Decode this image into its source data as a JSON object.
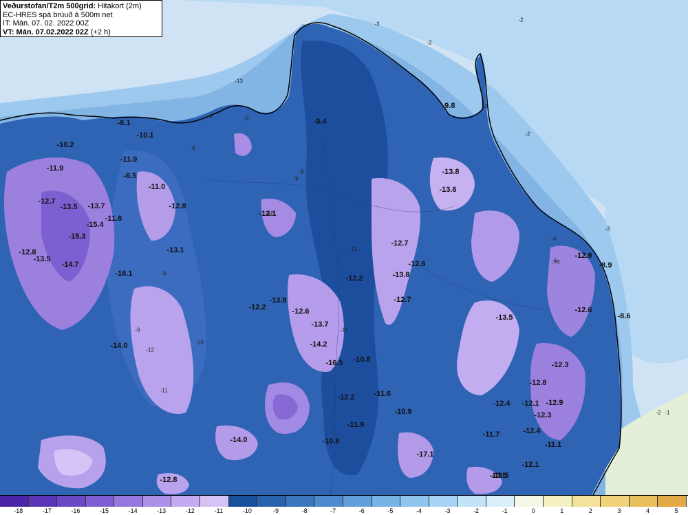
{
  "header": {
    "title_bold": "Veðurstofan/T2m 500grid:",
    "title_rest": " Hitakort (2m)",
    "model": "EC-HRES spá brúuð á 500m net",
    "issue_time": "IT: Mán. 07. 02. 2022 00Z",
    "valid_bold": "VT: Mán. 07.02.2022 02Z",
    "valid_rest": " (+2 h)"
  },
  "point_values": [
    "-8.1",
    "-10.2",
    "-10.1",
    "-11.9",
    "-11.9",
    "-6.5",
    "-11.0",
    "-12.7",
    "-13.5",
    "-13.7",
    "-12.8",
    "-11.8",
    "-15.4",
    "-15.3",
    "-12.8",
    "-13.5",
    "-14.7",
    "-13.1",
    "-16.1",
    "-14.0",
    "-9.4",
    "-9.8",
    "-12.1",
    "-13.8",
    "-13.6",
    "-12.7",
    "-12.6",
    "-13.8",
    "-12.2",
    "-12.7",
    "-12.2",
    "-13.8",
    "-12.6",
    "-13.7",
    "-14.2",
    "-16.5",
    "-10.8",
    "-12.2",
    "-11.6",
    "-10.9",
    "-11.9",
    "-10.8",
    "-14.0",
    "-12.8",
    "-17.1",
    "-13.5",
    "-12.9",
    "-8.9",
    "-12.6",
    "-8.6",
    "-13.5",
    "-12.3",
    "-12.8",
    "-12.1",
    "-12.9",
    "-12.3",
    "-12.4",
    "-12.4",
    "-11.7",
    "-11.1",
    "-12.1",
    "-13.5"
  ],
  "contour_labels": [
    "-2",
    "-2",
    "-3",
    "-3",
    "-2",
    "-13",
    "-4",
    "-5",
    "-6",
    "-1",
    "-2",
    "-3",
    "-4",
    "-5",
    "-6",
    "-7",
    "-8",
    "-9",
    "-10",
    "-11",
    "-12",
    "-8",
    "-9",
    "-10",
    "-11",
    "-12"
  ],
  "color_scale": {
    "labels": [
      "-18",
      "-17",
      "-16",
      "-15",
      "-14",
      "-13",
      "-12",
      "-11",
      "-10",
      "-9",
      "-8",
      "-7",
      "-6",
      "-5",
      "-4",
      "-3",
      "-2",
      "-1",
      "0",
      "1",
      "2",
      "3",
      "4",
      "5"
    ],
    "colors": [
      "#4b24a8",
      "#5a35b8",
      "#6a48c6",
      "#7e5fd3",
      "#9677df",
      "#ad90e8",
      "#c4aaf0",
      "#d6c3f6",
      "#1a4f9c",
      "#2a62ad",
      "#3b76bf",
      "#4d8bcf",
      "#629fdb",
      "#78b3e6",
      "#90c5ef",
      "#a8d5f5",
      "#c2e3f8",
      "#dbeffa",
      "#f2f7e6",
      "#f6f1c2",
      "#f3e29a",
      "#efd27a",
      "#e9bf5d",
      "#e3a944"
    ]
  },
  "map_colors": {
    "sea_far": "#cfe3f5",
    "sea_mid": "#a9d1f1",
    "sea_near": "#8fbfe9",
    "land_base": "#2f63b3",
    "land_cold": "#4a70c4",
    "lilac": "#a98de6",
    "lilac_light": "#c9b5f2",
    "purple": "#8d6ed8",
    "green_sea": "#e4efd8",
    "coast": "#000000"
  }
}
